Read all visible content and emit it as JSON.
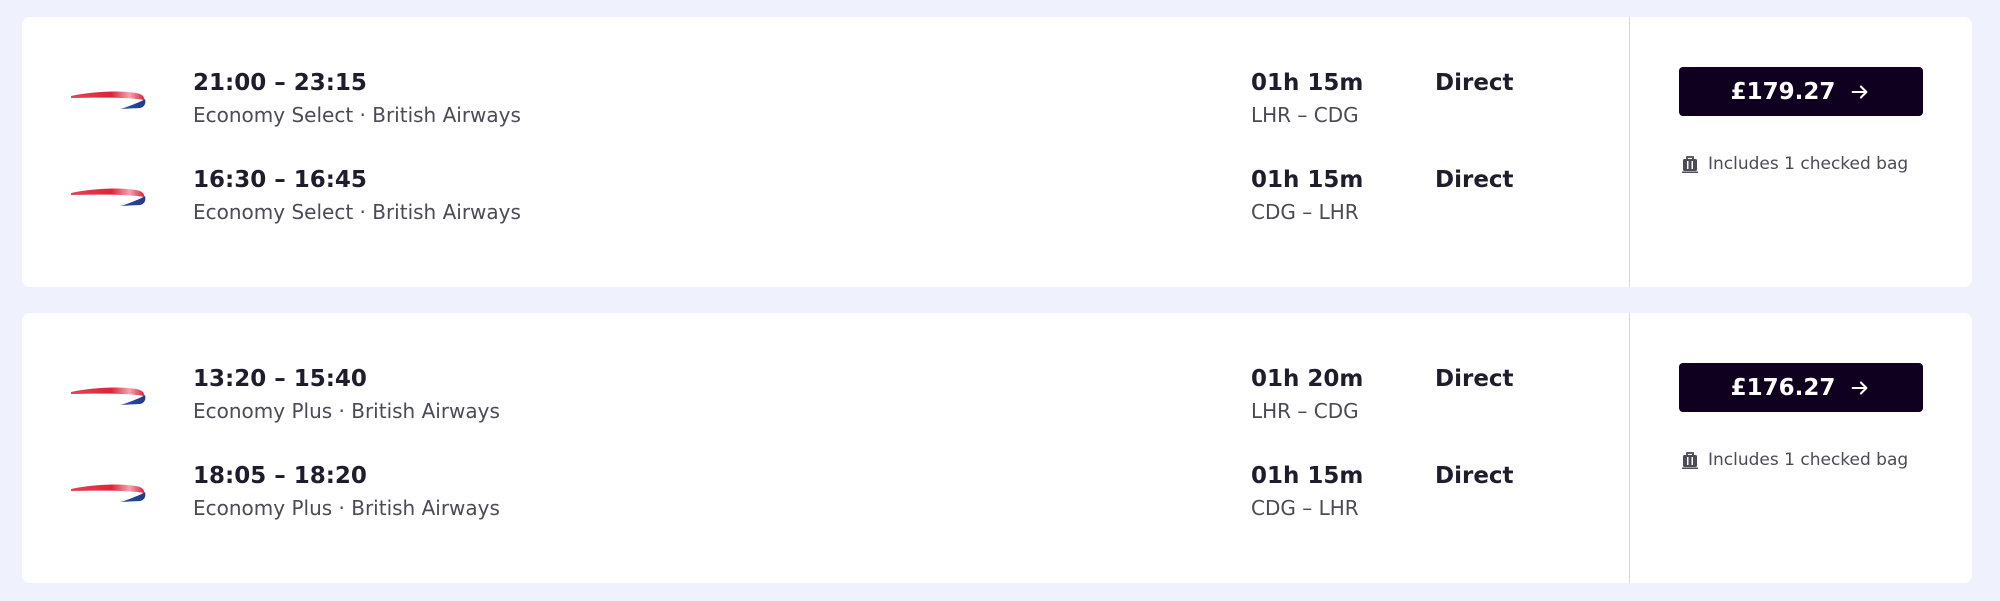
{
  "colors": {
    "page_background": "#eff2fd",
    "card_background": "#ffffff",
    "button_background": "#10001f",
    "secondary_text": "#4b4a55",
    "logo_red": "#e0223a",
    "logo_blue": "#2a4ea6"
  },
  "icons": {
    "airline_logo": "british-airways-speedmarque",
    "price_arrow": "arrow-right-icon",
    "baggage": "suitcase-icon"
  },
  "results": [
    {
      "legs": [
        {
          "times": "21:00 – 23:15",
          "fare_airline": "Economy Select · British Airways",
          "duration": "01h 15m",
          "route": "LHR – CDG",
          "stops": "Direct"
        },
        {
          "times": "16:30 – 16:45",
          "fare_airline": "Economy Select · British Airways",
          "duration": "01h 15m",
          "route": "CDG – LHR",
          "stops": "Direct"
        }
      ],
      "price": "£179.27",
      "baggage": "Includes 1 checked bag"
    },
    {
      "legs": [
        {
          "times": "13:20 – 15:40",
          "fare_airline": "Economy Plus · British Airways",
          "duration": "01h 20m",
          "route": "LHR – CDG",
          "stops": "Direct"
        },
        {
          "times": "18:05 – 18:20",
          "fare_airline": "Economy Plus · British Airways",
          "duration": "01h 15m",
          "route": "CDG – LHR",
          "stops": "Direct"
        }
      ],
      "price": "£176.27",
      "baggage": "Includes 1 checked bag"
    }
  ]
}
